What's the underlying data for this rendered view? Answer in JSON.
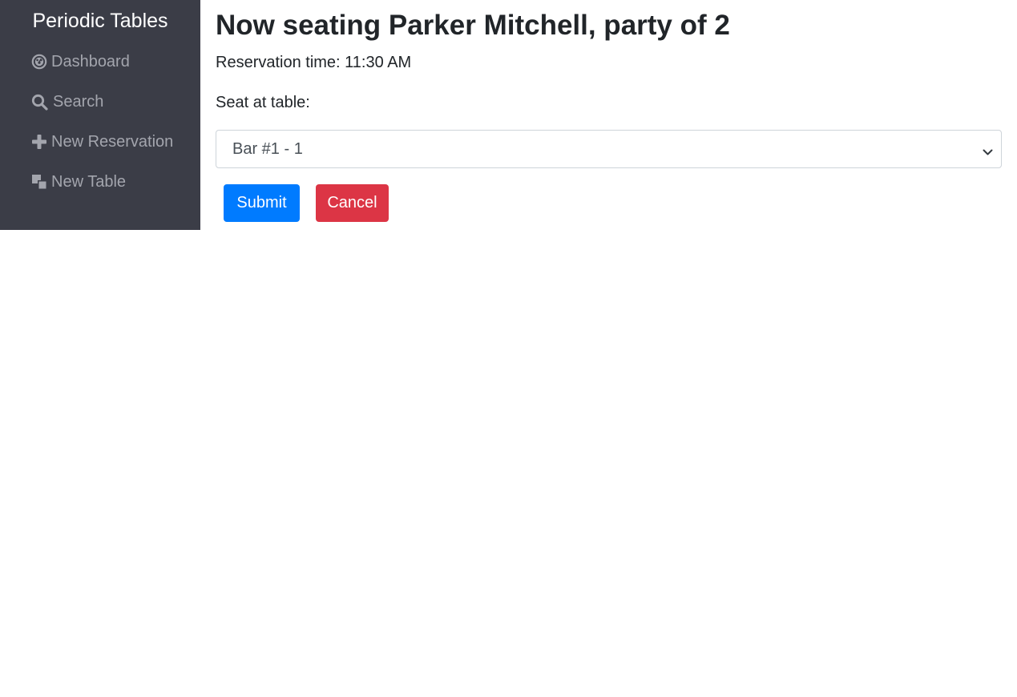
{
  "sidebar": {
    "brand": "Periodic Tables",
    "items": [
      {
        "label": "Dashboard",
        "icon": "dashboard-icon"
      },
      {
        "label": "Search",
        "icon": "search-icon"
      },
      {
        "label": "New Reservation",
        "icon": "plus-icon"
      },
      {
        "label": "New Table",
        "icon": "layers-icon"
      }
    ]
  },
  "main": {
    "title": "Now seating Parker Mitchell, party of 2",
    "reservation_time": "Reservation time: 11:30 AM",
    "seat_label": "Seat at table:",
    "table_select": {
      "selected": "Bar #1 - 1"
    },
    "submit_label": "Submit",
    "cancel_label": "Cancel"
  },
  "colors": {
    "sidebar_bg": "#3b3d47",
    "nav_text": "#a3a5ad",
    "primary": "#007bff",
    "danger": "#dc3545"
  }
}
